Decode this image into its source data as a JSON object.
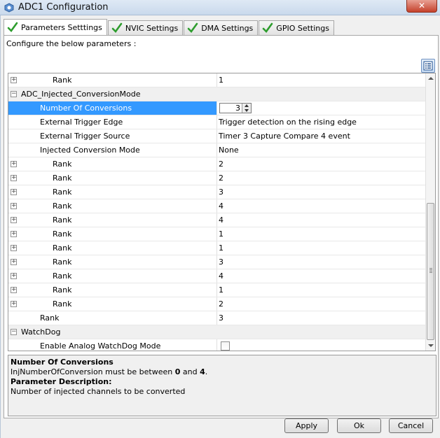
{
  "window": {
    "title": "ADC1 Configuration",
    "close_glyph": "✕"
  },
  "tabs": [
    {
      "label": "Parameters Setttings",
      "icon": "check-icon",
      "active": true
    },
    {
      "label": "NVIC Settings",
      "icon": "check-icon",
      "active": false
    },
    {
      "label": "DMA Settings",
      "icon": "check-icon",
      "active": false
    },
    {
      "label": "GPIO Settings",
      "icon": "check-icon",
      "active": false
    }
  ],
  "panel": {
    "instruction": "Configure the below parameters :",
    "view_toggle_icon": "list-view-icon"
  },
  "grid": {
    "rows": [
      {
        "kind": "item",
        "indent": 3,
        "expander": "plus",
        "name": "Rank",
        "value": "1"
      },
      {
        "kind": "group",
        "indent": 1,
        "expander": "minus",
        "name": "ADC_Injected_ConversionMode",
        "value": ""
      },
      {
        "kind": "spinner",
        "indent": 2,
        "expander": "",
        "name": "Number Of Conversions",
        "value": "3",
        "selected": true
      },
      {
        "kind": "item",
        "indent": 2,
        "expander": "",
        "name": "External Trigger Edge",
        "value": "Trigger detection on the rising edge"
      },
      {
        "kind": "item",
        "indent": 2,
        "expander": "",
        "name": "External Trigger Source",
        "value": "Timer 3 Capture Compare 4 event"
      },
      {
        "kind": "item",
        "indent": 2,
        "expander": "",
        "name": "Injected Conversion Mode",
        "value": "None"
      },
      {
        "kind": "item",
        "indent": 3,
        "expander": "plus",
        "name": "Rank",
        "value": "2"
      },
      {
        "kind": "item",
        "indent": 3,
        "expander": "plus",
        "name": "Rank",
        "value": "2"
      },
      {
        "kind": "item",
        "indent": 3,
        "expander": "plus",
        "name": "Rank",
        "value": "3"
      },
      {
        "kind": "item",
        "indent": 3,
        "expander": "plus",
        "name": "Rank",
        "value": "4"
      },
      {
        "kind": "item",
        "indent": 3,
        "expander": "plus",
        "name": "Rank",
        "value": "4"
      },
      {
        "kind": "item",
        "indent": 3,
        "expander": "plus",
        "name": "Rank",
        "value": "1"
      },
      {
        "kind": "item",
        "indent": 3,
        "expander": "plus",
        "name": "Rank",
        "value": "1"
      },
      {
        "kind": "item",
        "indent": 3,
        "expander": "plus",
        "name": "Rank",
        "value": "3"
      },
      {
        "kind": "item",
        "indent": 3,
        "expander": "plus",
        "name": "Rank",
        "value": "4"
      },
      {
        "kind": "item",
        "indent": 3,
        "expander": "plus",
        "name": "Rank",
        "value": "1"
      },
      {
        "kind": "item",
        "indent": 3,
        "expander": "plus",
        "name": "Rank",
        "value": "2"
      },
      {
        "kind": "item",
        "indent": 2,
        "expander": "",
        "name": "Rank",
        "value": "3"
      },
      {
        "kind": "group",
        "indent": 1,
        "expander": "minus",
        "name": "WatchDog",
        "value": ""
      },
      {
        "kind": "checkbox",
        "indent": 2,
        "expander": "",
        "name": "Enable Analog WatchDog Mode",
        "value": "",
        "checked": false
      }
    ]
  },
  "description": {
    "title": "Number Of Conversions",
    "constraint_prefix": "InjNumberOfConversion must be between ",
    "min": "0",
    "constraint_mid": " and ",
    "max": "4",
    "constraint_suffix": ".",
    "section_heading": "Parameter Description:",
    "text": "Number of injected channels to be converted"
  },
  "buttons": {
    "apply": "Apply",
    "ok": "Ok",
    "cancel": "Cancel"
  },
  "colors": {
    "selection": "#3399ff",
    "check_green": "#2e9d2e"
  }
}
